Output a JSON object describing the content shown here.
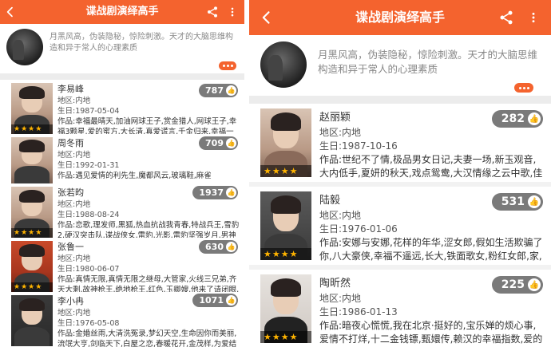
{
  "app": {
    "title": "谍战剧演绎高手",
    "description": "月黑风高，伪装隐秘，惊险刺激。天才的大脑思维构造和异于常人的心理素质"
  },
  "icons": {
    "back": "back-arrow-icon",
    "share": "share-icon",
    "more": "more-vertical-icon",
    "expand": "more-dots-icon",
    "like": "like-icon"
  },
  "colors": {
    "accent": "#f4632e",
    "score_badge": "#7a7a7a",
    "star": "#ffb400"
  },
  "stars_text": "★★★★",
  "left": {
    "actors": [
      {
        "name": "李易峰",
        "region": "地区:内地",
        "birth": "生日:1987-05-04",
        "works": "作品:幸福最晴天,加油网球王子,赏金猎人,网球王子,幸福3颗星,爱的蜜方,大长清,真爱谎言,千金归来,幸福一定...",
        "score": "787"
      },
      {
        "name": "周冬雨",
        "region": "地区:内地",
        "birth": "生日:1992-01-31",
        "works": "作品:遇见爱情的利先生,魔都风云,玻璃鞋,麻雀",
        "score": "709"
      },
      {
        "name": "张若昀",
        "region": "地区:内地",
        "birth": "生日:1988-08-24",
        "works": "作品:恋歌,理发师,黑狐,热血抗战我青春,特战兵王,雪豹2,硬汉突击队,谍战侠女,雷豹,光影,雷豹坚强岁月,男神执...",
        "score": "1937"
      },
      {
        "name": "张鲁一",
        "region": "地区:内地",
        "birth": "生日:1980-06-07",
        "works": "作品:真情无限,真情无限之继母,大管家,火线三兄弟,齐天大剩,故神枪王,绝地枪王,红色,玉卿嫂,他来了请闭眼,谈...",
        "score": "630"
      },
      {
        "name": "李小冉",
        "region": "地区:内地",
        "birth": "生日:1976-05-08",
        "works": "作品:金婚丝雨,大清洗冤录,梦幻天空,生命因你而美丽,流氓大亨,剑临天下,白屋之恋,春暖花开,金茂样,为爱结婚,...",
        "score": "1071"
      }
    ]
  },
  "right": {
    "actors": [
      {
        "name": "赵丽颖",
        "region": "地区:内地",
        "birth": "生日:1987-10-16",
        "works": "作品:世纪不了情,极品男女日记,夫妻一场,新玉观音,大内低手,夏妍的秋天,戏点鸳鸯,大汉情缘之云中歌,佳期如...",
        "score": "282"
      },
      {
        "name": "陆毅",
        "region": "地区:内地",
        "birth": "生日:1976-01-06",
        "works": "作品:安娜与安娜,花样的年华,涩女郎,假如生活欺骗了你,八大豪侠,幸福不遥远,长大,铁面歌女,粉红女郎,家,永不...",
        "score": "531"
      },
      {
        "name": "陶昕然",
        "region": "地区:内地",
        "birth": "生日:1986-01-13",
        "works": "作品:暗夜心慌慌,我在北京·挺好的,宝乐婵的烦心事,爱情不打烊,十二金钱镖,甄嬛传,赖汉的幸福指数,爱的契约,...",
        "score": "225"
      }
    ]
  }
}
